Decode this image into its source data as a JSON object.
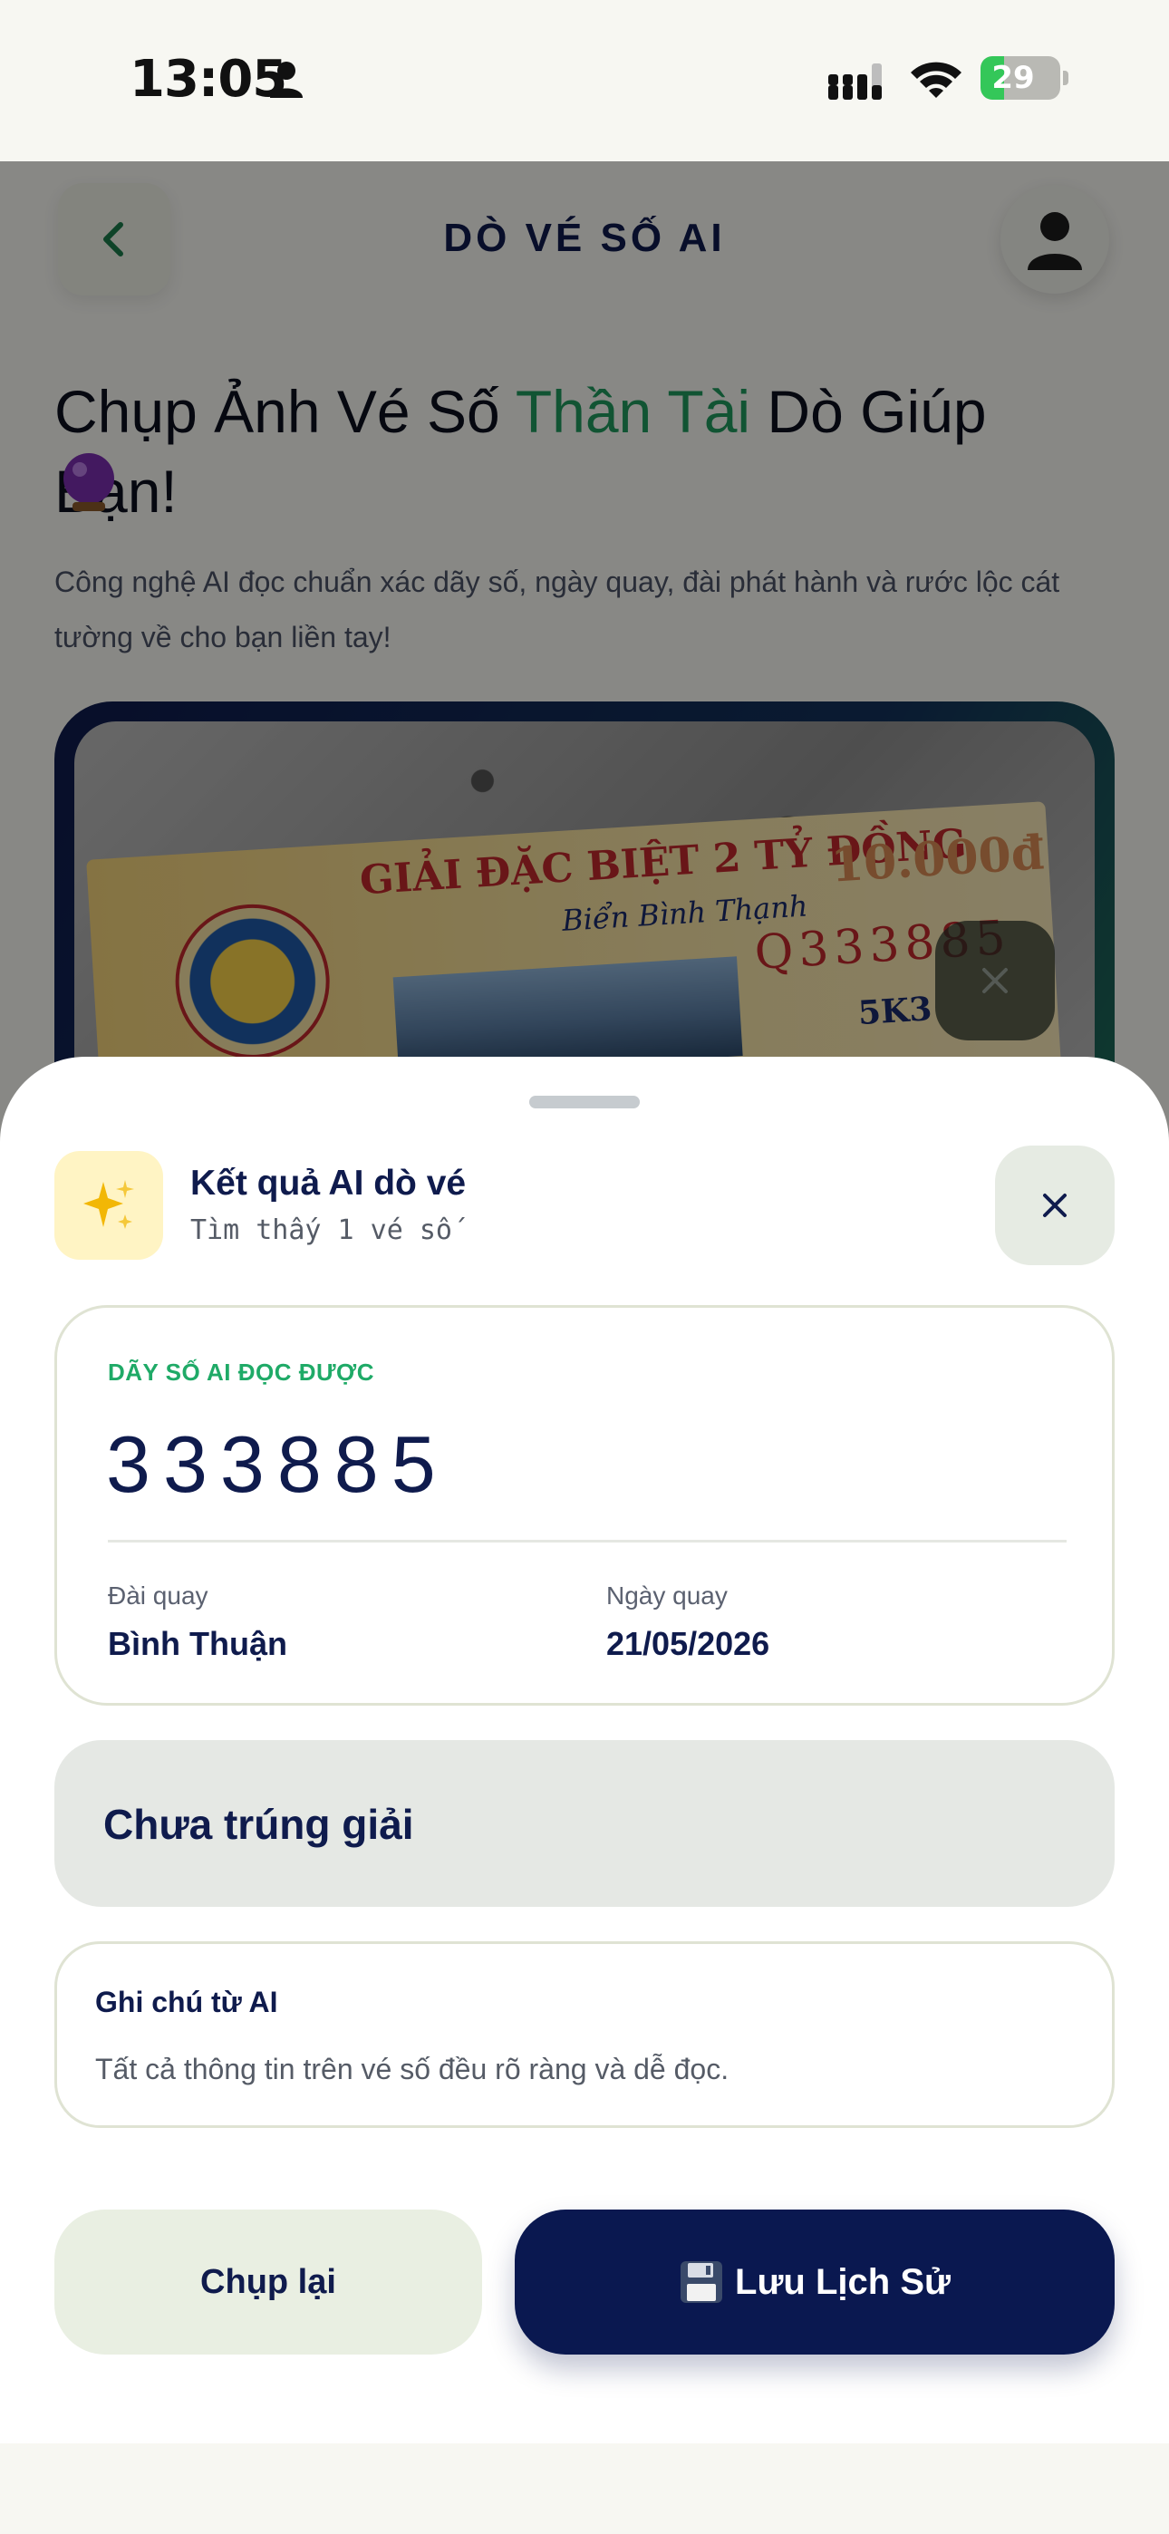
{
  "status_bar": {
    "time": "13:05",
    "battery": "29",
    "battery_level": 0.29
  },
  "header": {
    "title": "DÒ VÉ SỐ AI",
    "back_icon": "chevron-left-icon",
    "avatar_icon": "person-icon"
  },
  "hero": {
    "title_part1": "Chụp Ảnh Vé Số ",
    "title_accent": "Thần Tài",
    "title_part2": " Dò Giúp Bạn!",
    "description": "Công nghệ AI đọc chuẩn xác dãy số, ngày quay, đài phát hành và rước lộc cát tường về cho bạn liền tay!"
  },
  "ticket_photo": {
    "heading": "GIẢI ĐẶC BIỆT 2 TỶ ĐỒNG",
    "subheading": "Biển Bình Thạnh",
    "price": "10.000đ",
    "number": "Q333885",
    "code": "5K3"
  },
  "sheet": {
    "icon": "sparkles-icon",
    "title": "Kết quả AI dò vé",
    "subtitle": "Tìm thấy 1 vé số",
    "number_label": "DÃY SỐ AI ĐỌC ĐƯỢC",
    "number_value": "333885",
    "station_label": "Đài quay",
    "station_value": "Bình Thuận",
    "date_label": "Ngày quay",
    "date_value": "21/05/2026",
    "result": "Chưa trúng giải",
    "note_title": "Ghi chú từ AI",
    "note_text": "Tất cả thông tin trên vé số đều rõ ràng và dễ đọc.",
    "retake_label": "Chụp lại",
    "save_label": "Lưu Lịch Sử"
  },
  "colors": {
    "accent_green": "#1f9a5e",
    "navy": "#0a1850",
    "label_green": "#1faa67"
  }
}
